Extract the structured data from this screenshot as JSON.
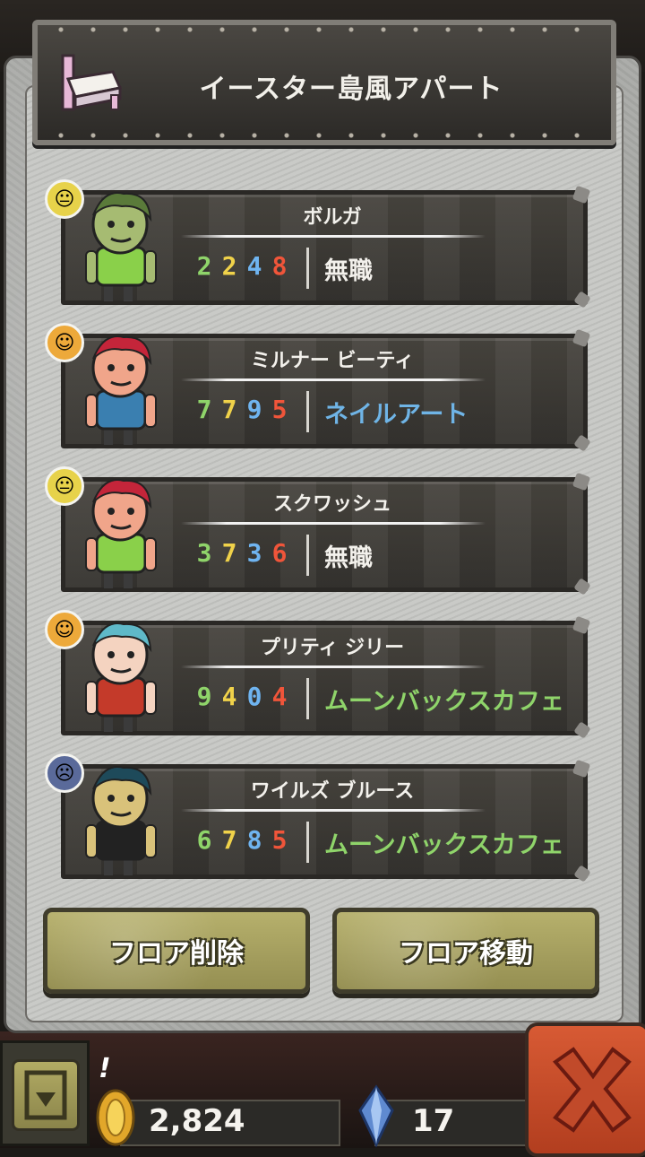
{
  "header": {
    "title": "イースター島風アパート",
    "icon": "bed-icon"
  },
  "residents": [
    {
      "name": "ボルガ",
      "stats": [
        "2",
        "2",
        "4",
        "8"
      ],
      "stat_colors": [
        "#8fd46a",
        "#f0d24a",
        "#6fb4f0",
        "#f0553a"
      ],
      "job": "無職",
      "job_color": "#f3f1ec",
      "mood": "neutral",
      "mood_color": "#e7d24a"
    },
    {
      "name": "ミルナー ビーティ",
      "stats": [
        "7",
        "7",
        "9",
        "5"
      ],
      "stat_colors": [
        "#8fd46a",
        "#f0d24a",
        "#6fb4f0",
        "#f0553a"
      ],
      "job": "ネイルアート",
      "job_color": "#6fb4e6",
      "mood": "happy",
      "mood_color": "#eda93a"
    },
    {
      "name": "スクワッシュ",
      "stats": [
        "3",
        "7",
        "3",
        "6"
      ],
      "stat_colors": [
        "#8fd46a",
        "#f0d24a",
        "#6fb4f0",
        "#f0553a"
      ],
      "job": "無職",
      "job_color": "#f3f1ec",
      "mood": "neutral",
      "mood_color": "#e7d24a"
    },
    {
      "name": "プリティ ジリー",
      "stats": [
        "9",
        "4",
        "0",
        "4"
      ],
      "stat_colors": [
        "#8fd46a",
        "#f0d24a",
        "#6fb4f0",
        "#f0553a"
      ],
      "job": "ムーンバックスカフェ",
      "job_color": "#8fd46a",
      "mood": "happy",
      "mood_color": "#eda93a"
    },
    {
      "name": "ワイルズ ブルース",
      "stats": [
        "6",
        "7",
        "8",
        "5"
      ],
      "stat_colors": [
        "#8fd46a",
        "#f0d24a",
        "#6fb4f0",
        "#f0553a"
      ],
      "job": "ムーンバックスカフェ",
      "job_color": "#8fd46a",
      "mood": "sad",
      "mood_color": "#5a6a9a"
    }
  ],
  "buttons": {
    "delete_floor": "フロア削除",
    "move_floor": "フロア移動"
  },
  "footer": {
    "alert": "!",
    "coins": "2,824",
    "gems": "17"
  }
}
